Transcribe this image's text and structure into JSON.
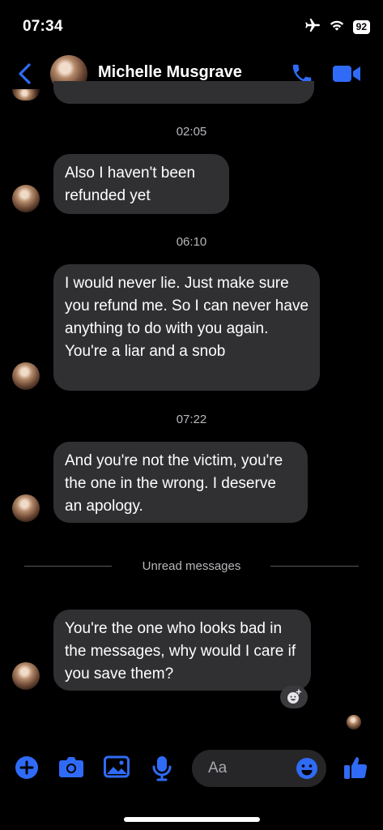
{
  "status_bar": {
    "time": "07:34",
    "battery": "92"
  },
  "header": {
    "contact_name": "Michelle Musgrave"
  },
  "messages": [
    {
      "timestamp": "02:05",
      "text": "Also I haven't been refunded yet"
    },
    {
      "timestamp": "06:10",
      "text": "I would never lie. Just make sure you refund me. So I can never have anything to do with you again. You're a liar and a snob"
    },
    {
      "timestamp": "07:22",
      "text": "And you're not the victim, you're the one in the wrong. I deserve an apology."
    }
  ],
  "unread_divider": "Unread messages",
  "unread_messages": [
    {
      "text": "You're the one who looks bad in the messages, why would I care if you save them?"
    }
  ],
  "composer": {
    "placeholder": "Aa"
  },
  "colors": {
    "accent": "#2f6bf6",
    "bubble": "#303033",
    "background": "#000000",
    "muted_text": "#b8b8bd"
  },
  "icons": [
    "airplane-icon",
    "wifi-icon",
    "back-icon",
    "phone-icon",
    "video-icon",
    "plus-icon",
    "camera-icon",
    "image-icon",
    "microphone-icon",
    "emoji-icon",
    "thumbs-up-icon",
    "add-reaction-icon"
  ]
}
